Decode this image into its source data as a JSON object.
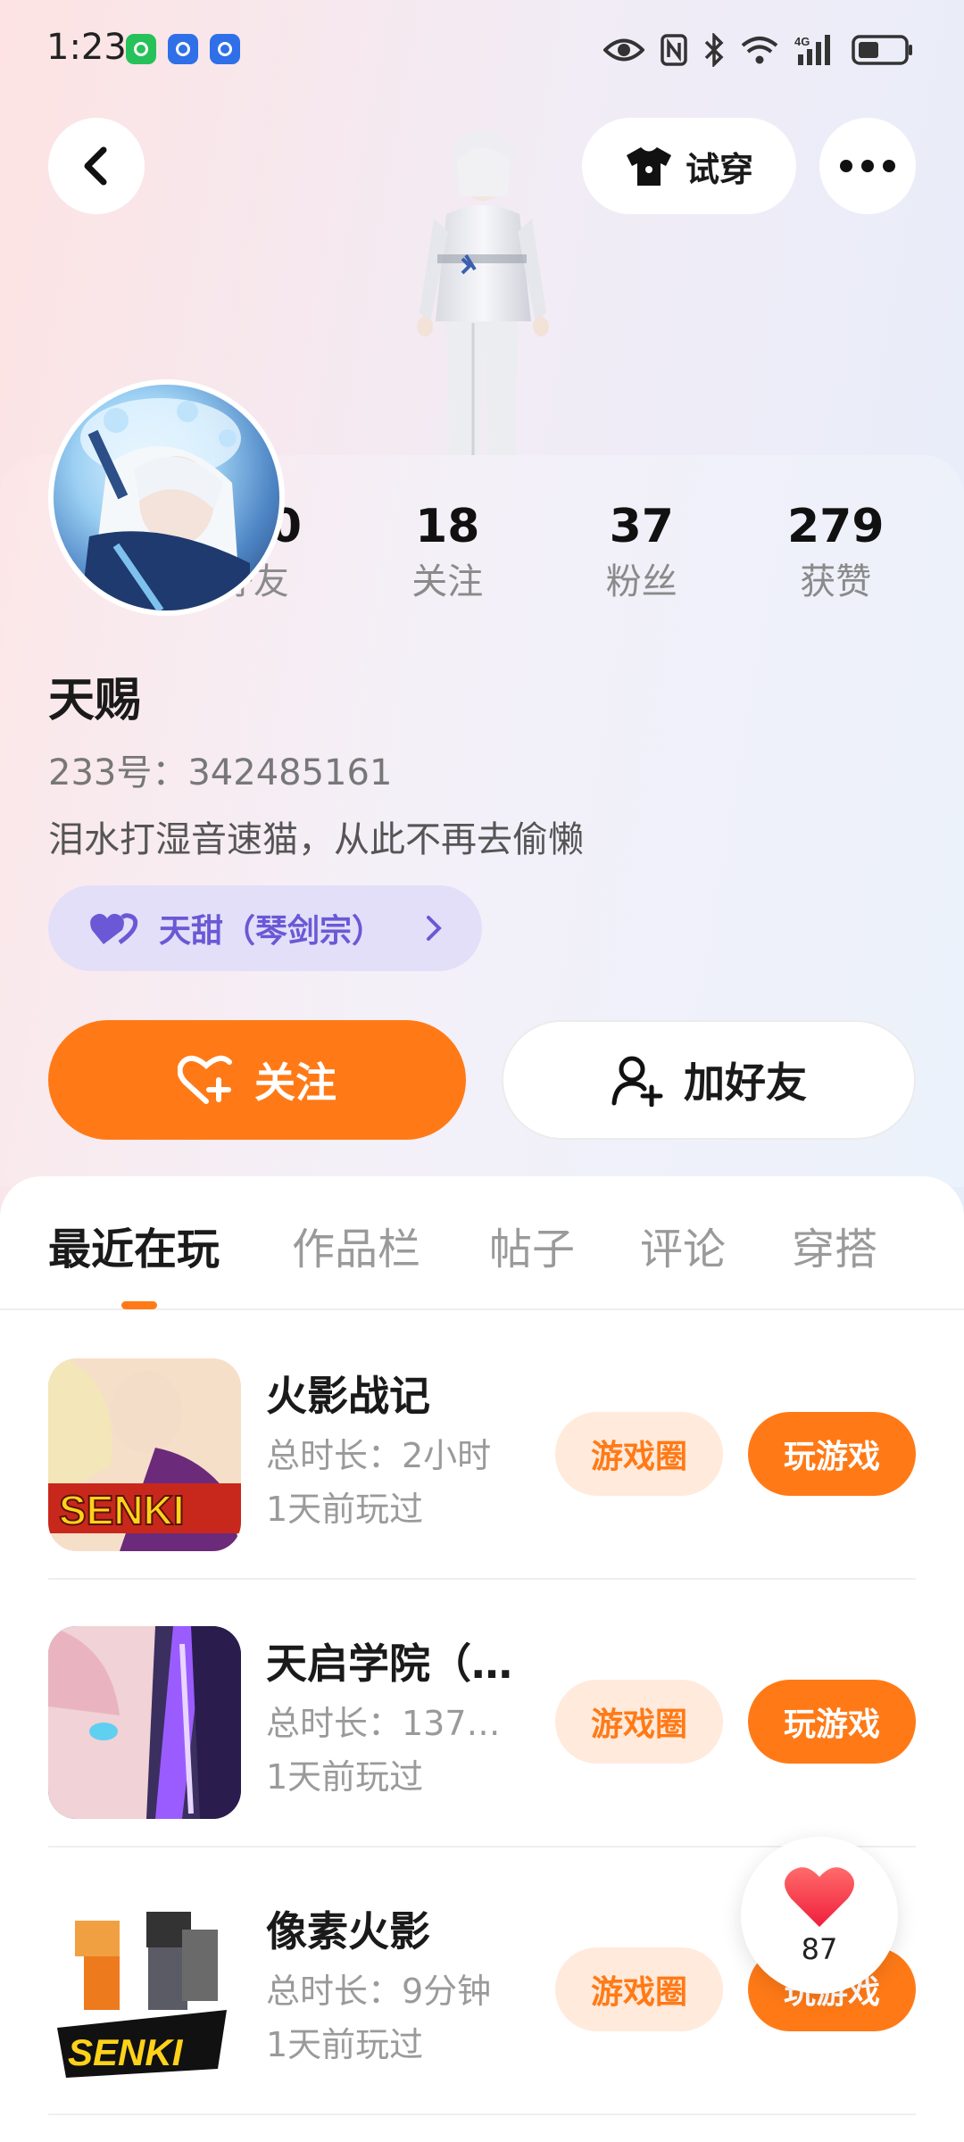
{
  "status_bar": {
    "time": "1:23"
  },
  "header": {
    "try_on_label": "试穿"
  },
  "profile": {
    "stats": [
      {
        "value": "420",
        "label": "好友"
      },
      {
        "value": "18",
        "label": "关注"
      },
      {
        "value": "37",
        "label": "粉丝"
      },
      {
        "value": "279",
        "label": "获赞"
      }
    ],
    "username": "天赐",
    "user_id": "233号：342485161",
    "signature": "泪水打湿音速猫，从此不再去偷懒",
    "guild_tag": "天甜（琴剑宗）",
    "follow_label": "关注",
    "add_friend_label": "加好友"
  },
  "tabs": [
    {
      "label": "最近在玩",
      "active": true
    },
    {
      "label": "作品栏",
      "active": false
    },
    {
      "label": "帖子",
      "active": false
    },
    {
      "label": "评论",
      "active": false
    },
    {
      "label": "穿搭",
      "active": false
    }
  ],
  "games": [
    {
      "name": "火影战记",
      "duration": "总时长：2小时",
      "last_played": "1天前玩过",
      "circle_label": "游戏圈",
      "play_label": "玩游戏"
    },
    {
      "name": "天启学院（…",
      "duration": "总时长：137…",
      "last_played": "1天前玩过",
      "circle_label": "游戏圈",
      "play_label": "玩游戏"
    },
    {
      "name": "像素火影",
      "duration": "总时长：9分钟",
      "last_played": "1天前玩过",
      "circle_label": "游戏圈",
      "play_label": "玩游戏"
    }
  ],
  "like_float": {
    "count": "87"
  },
  "colors": {
    "accent": "#ff7a17",
    "accent_light": "#ffeadb",
    "guild_bg": "#e3dff8",
    "guild_text": "#6a58d6"
  }
}
